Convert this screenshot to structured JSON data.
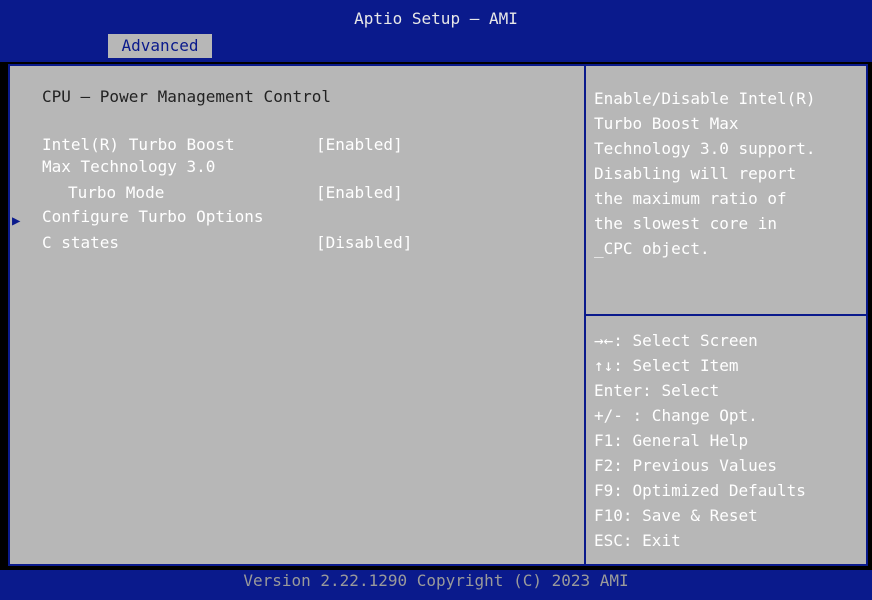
{
  "header": {
    "title": "Aptio Setup – AMI",
    "tab": "Advanced"
  },
  "main": {
    "section_title": "CPU – Power Management Control",
    "items": [
      {
        "label_line1": "Intel(R) Turbo Boost",
        "label_line2": "Max Technology 3.0",
        "value": "[Enabled]"
      },
      {
        "label": "Turbo Mode",
        "value": "[Enabled]"
      },
      {
        "label": "Configure Turbo Options",
        "submenu_icon": "right-triangle-icon"
      },
      {
        "label": "C states",
        "value": "[Disabled]"
      }
    ]
  },
  "help": {
    "description": "Enable/Disable Intel(R)\nTurbo Boost Max\nTechnology 3.0 support.\nDisabling will report\nthe maximum ratio of\nthe slowest core in\n_CPC object.",
    "keys": [
      {
        "key": "→←",
        "desc": ": Select Screen"
      },
      {
        "key": "↑↓",
        "desc": ": Select Item"
      },
      {
        "key": "Enter",
        "desc": ": Select"
      },
      {
        "key": "+/-",
        "desc": " : Change Opt."
      },
      {
        "key": "F1",
        "desc": ": General Help"
      },
      {
        "key": "F2",
        "desc": ": Previous Values"
      },
      {
        "key": "F9",
        "desc": ": Optimized Defaults"
      },
      {
        "key": "F10",
        "desc": ": Save & Reset"
      },
      {
        "key": "ESC",
        "desc": ": Exit"
      }
    ]
  },
  "footer": {
    "version": "Version 2.22.1290 Copyright (C) 2023 AMI"
  },
  "colors": {
    "bios_blue": "#0a1a8c",
    "panel_gray": "#b7b7b7",
    "text_white": "#ffffff",
    "title_dark": "#222222"
  }
}
